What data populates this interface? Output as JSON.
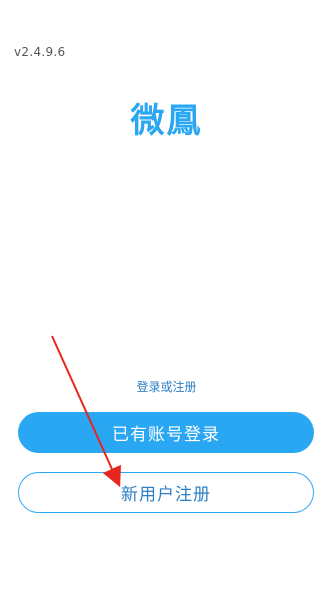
{
  "app": {
    "version": "v2.4.9.6",
    "title": "微鳳"
  },
  "auth": {
    "subtitle": "登录或注册",
    "login_label": "已有账号登录",
    "register_label": "新用户注册"
  },
  "colors": {
    "accent": "#2aa7f3",
    "link": "#2a7fc6",
    "annotation_arrow": "#e8261d"
  }
}
